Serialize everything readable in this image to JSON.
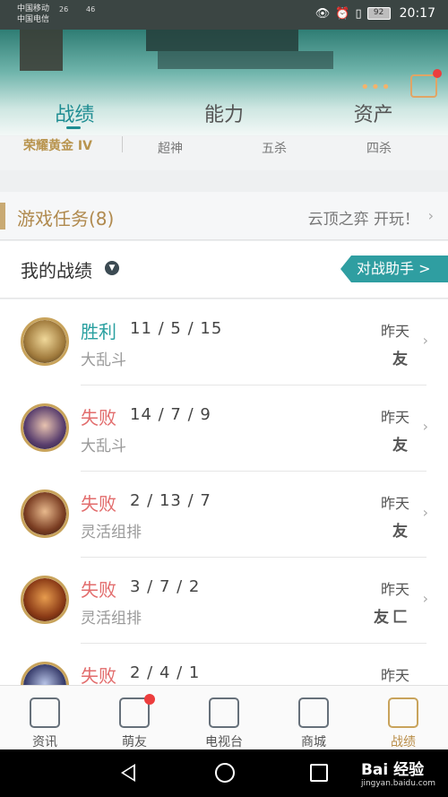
{
  "status_bar": {
    "carrier_1": "中国移动",
    "carrier_2": "中国电信",
    "signal_1": "26",
    "signal_2": "46",
    "battery": "92",
    "time": "20:17"
  },
  "top_tabs": [
    "战绩",
    "能力",
    "资产"
  ],
  "active_tab": "战绩",
  "rank_row": {
    "rank": "荣耀黄金 IV",
    "items": [
      "超神",
      "五杀",
      "四杀"
    ]
  },
  "missions": {
    "title": "游戏任务(8)",
    "right_text": "云顶之弈 开玩！"
  },
  "my_record": {
    "title": "我的战绩",
    "assist_button": "对战助手 >"
  },
  "matches": [
    {
      "result": "胜利",
      "kda": "11 / 5 / 15",
      "mode": "大乱斗",
      "date": "昨天",
      "tags": [
        "友"
      ],
      "win": true
    },
    {
      "result": "失败",
      "kda": "14 / 7 / 9",
      "mode": "大乱斗",
      "date": "昨天",
      "tags": [
        "友"
      ],
      "win": false
    },
    {
      "result": "失败",
      "kda": "2 / 13 / 7",
      "mode": "灵活组排",
      "date": "昨天",
      "tags": [
        "友"
      ],
      "win": false
    },
    {
      "result": "失败",
      "kda": "3 / 7 / 2",
      "mode": "灵活组排",
      "date": "昨天",
      "tags": [
        "友",
        "匚"
      ],
      "win": false
    },
    {
      "result": "失败",
      "kda": "2 / 4 / 1",
      "mode": "",
      "date": "昨天",
      "tags": [],
      "win": false
    }
  ],
  "bottom_nav": [
    "资讯",
    "萌友",
    "电视台",
    "商城",
    "战绩"
  ],
  "watermark": {
    "brand": "Bai 经验",
    "url": "jingyan.baidu.com"
  },
  "colors": {
    "accent": "#2f9ea1",
    "gold": "#c8a35b",
    "win": "#2aa0a0",
    "lose": "#e26c6c"
  }
}
